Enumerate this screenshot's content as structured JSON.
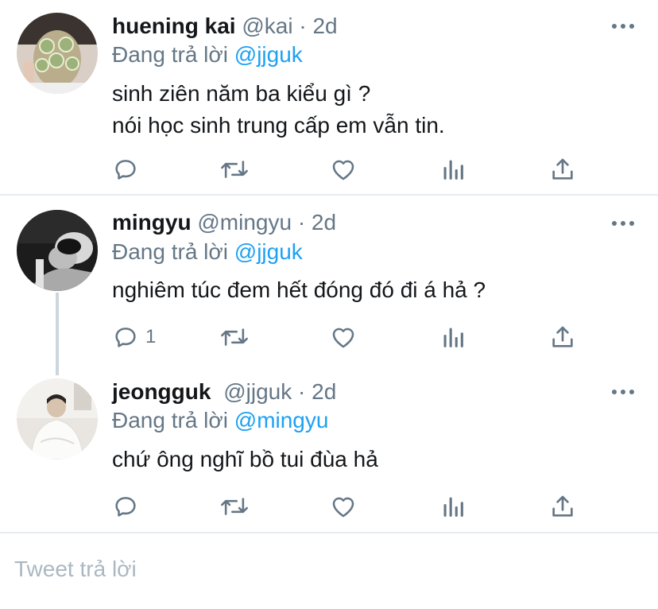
{
  "tweets": [
    {
      "name": "huening kai",
      "handle": "@kai",
      "separator": "·",
      "time": "2d",
      "replying_prefix": "Đang trả lời",
      "replying_to": "@jjguk",
      "lines": [
        "sinh ziên năm ba kiểu gì ?",
        "nói học sinh trung cấp em vẫn tin."
      ],
      "reply_count": "",
      "avatar_icon": "user-avatar-cucumber-mask"
    },
    {
      "name": "mingyu",
      "handle": "@mingyu",
      "separator": "·",
      "time": "2d",
      "replying_prefix": "Đang trả lời",
      "replying_to": "@jjguk",
      "lines": [
        "nghiêm túc đem hết đóng đó đi á hả ?"
      ],
      "reply_count": "1",
      "avatar_icon": "user-avatar-bw-portrait"
    },
    {
      "name": "jeongguk",
      "handle": "@jjguk",
      "separator": "·",
      "time": "2d",
      "replying_prefix": "Đang trả lời",
      "replying_to": "@mingyu",
      "lines": [
        "chứ ông nghĩ bồ tui đùa hả"
      ],
      "reply_count": "",
      "avatar_icon": "user-avatar-white-room"
    }
  ],
  "compose": {
    "placeholder": "Tweet trả lời"
  },
  "icons": [
    "reply-icon",
    "retweet-icon",
    "like-icon",
    "analytics-icon",
    "share-icon",
    "more-options-icon"
  ],
  "colors": {
    "text": "#14171a",
    "muted": "#657786",
    "link": "#1da1f2",
    "divider": "#e6ecf0",
    "thread_line": "#ccd6dd",
    "placeholder": "#aab8c2"
  }
}
